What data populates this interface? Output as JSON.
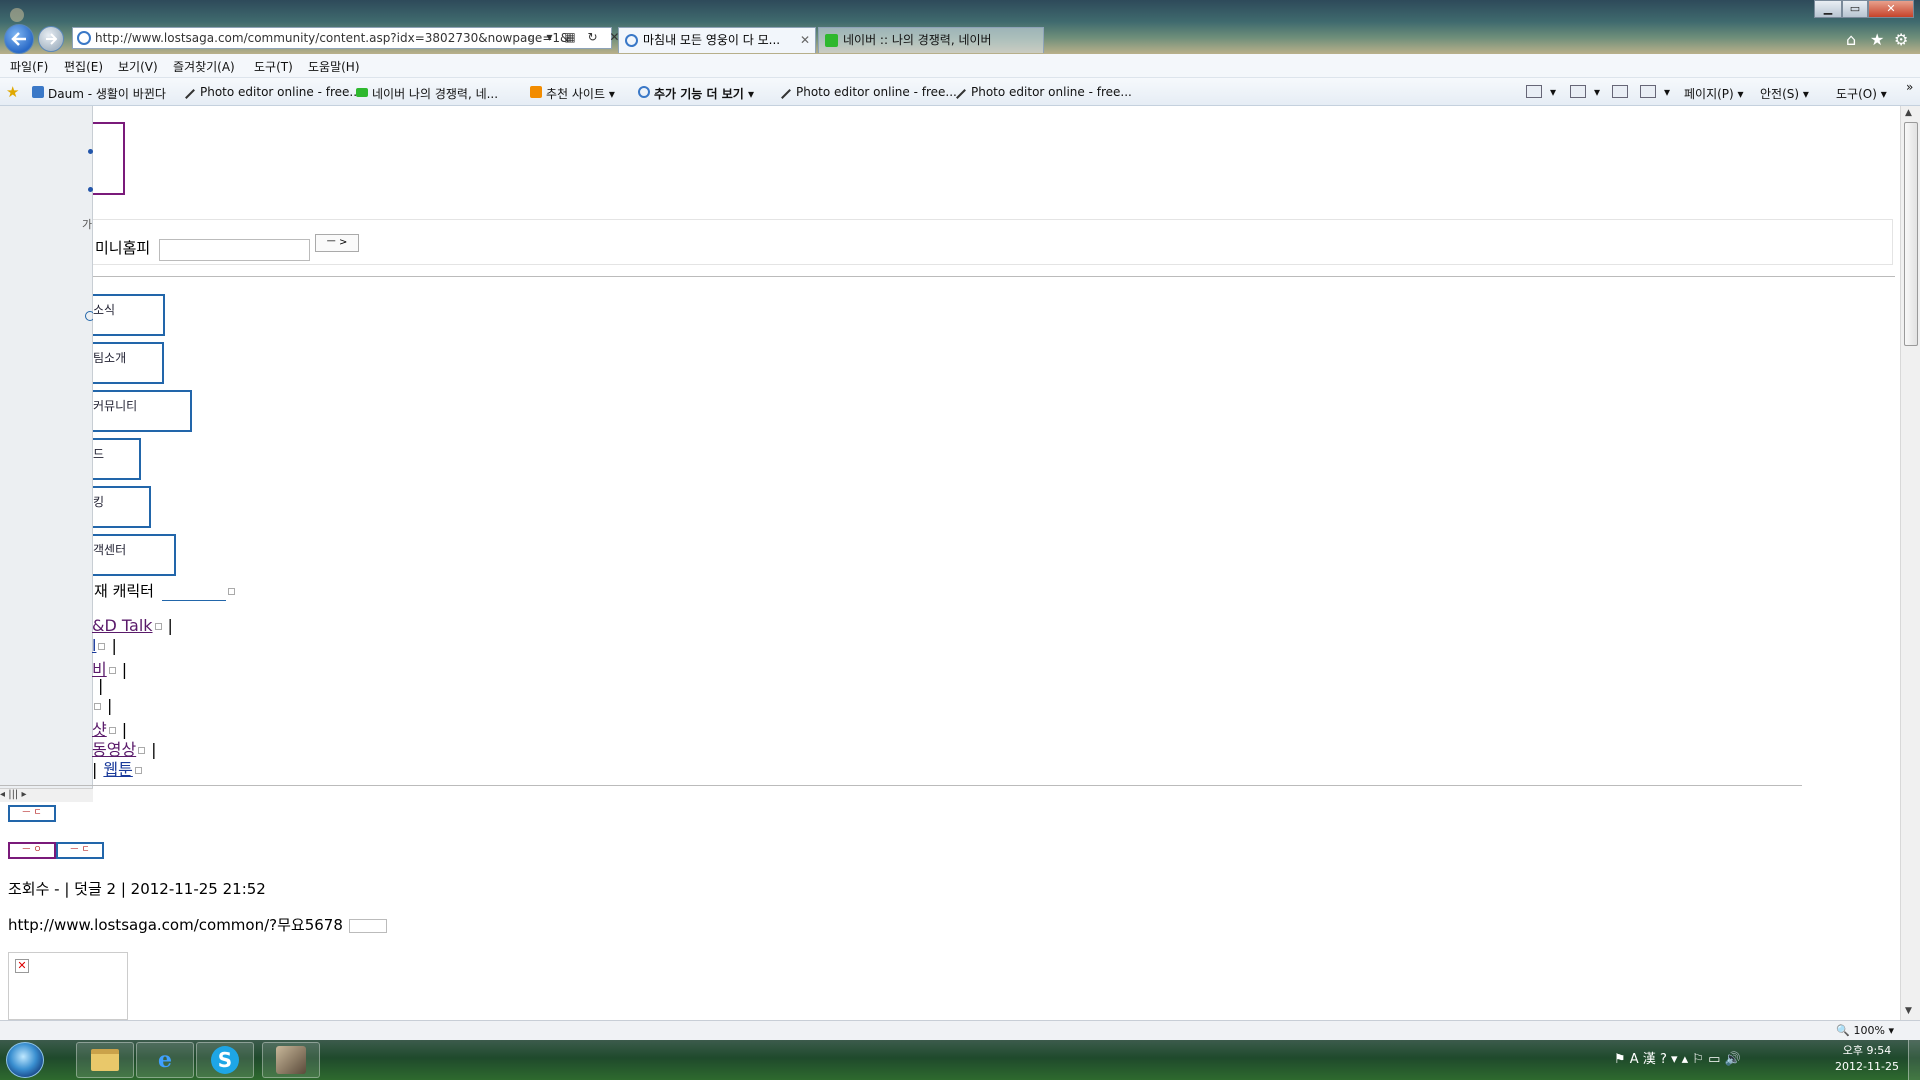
{
  "browser": {
    "url": "http://www.lostsaga.com/community/content.asp?idx=3802730&nowpage=1&",
    "address_tools": "⌕ ▾ ▦ ↻ ✕",
    "tabs": [
      {
        "label": "마침내 모든 영웅이 다 모...",
        "close": "✕"
      },
      {
        "label": "네이버 :: 나의 경쟁력, 네이버"
      }
    ],
    "window_controls": {
      "min": "▁",
      "max": "▭",
      "close": "✕"
    },
    "right_icons": {
      "home": "⌂",
      "favorites": "★",
      "tools": "⚙"
    }
  },
  "menu": [
    "파일(F)",
    "편집(E)",
    "보기(V)",
    "즐겨찾기(A)",
    "도구(T)",
    "도움말(H)"
  ],
  "favorites": [
    {
      "label": "Daum - 생활이 바뀐다",
      "icon": "daum-icon"
    },
    {
      "label": "Photo editor online - free...",
      "icon": "pen-icon"
    },
    {
      "label": "네이버 나의 경쟁력, 네...",
      "icon": "naver-icon"
    },
    {
      "label": "추천 사이트 ▾",
      "icon": "suggested-icon"
    },
    {
      "label": "추가 기능 더 보기 ▾",
      "icon": "ie-icon",
      "bold": true
    },
    {
      "label": "Photo editor online - free...",
      "icon": "pen-icon"
    },
    {
      "label": "Photo editor online - free...",
      "icon": "pen-icon"
    }
  ],
  "command_bar": {
    "page": "페이지(P) ▾",
    "safety": "안전(S) ▾",
    "tools": "도구(O) ▾",
    "chevron": "»",
    "dropdown": "▾"
  },
  "page": {
    "small_ga": "가",
    "search_label": "미니홈피",
    "search_button": "ㅡ >",
    "nav_items": [
      "소식",
      "팀소개",
      "커뮤니티",
      "드",
      "킹",
      "객센터"
    ],
    "character_line": "재 캐릭터",
    "links": [
      {
        "text": "&D Talk",
        "pipe": "|"
      },
      {
        "text": "l",
        "pipe": "|"
      },
      {
        "text": "비",
        "pipe": "|"
      },
      {
        "text": "",
        "pipe": "|"
      },
      {
        "text": "",
        "pipe": "|"
      },
      {
        "text": "샷",
        "pipe": "|"
      },
      {
        "text": "동영상",
        "pipe": "|"
      },
      {
        "text": "웹툰",
        "pipe": "|"
      }
    ],
    "button_1": "ㅡ ㄷ",
    "button_2": "ㅡ ㅇ",
    "button_3": "ㅡ ㄷ",
    "views_line": "조회수 - | 덧글 2 | 2012-11-25 21:52",
    "url_line": "http://www.lostsaga.com/common/?무요5678",
    "broken_image": "✕",
    "left_scroll": "◂ ||| ▸"
  },
  "scrollbar": {
    "up": "▲",
    "down": "▼"
  },
  "status": {
    "zoom": "🔍 100% ▾"
  },
  "taskbar": {
    "tray": "⚑ A 漢 ? ▾ ▴ ⚐ ▭ 🔊",
    "time": "오후 9:54",
    "date": "2012-11-25"
  }
}
